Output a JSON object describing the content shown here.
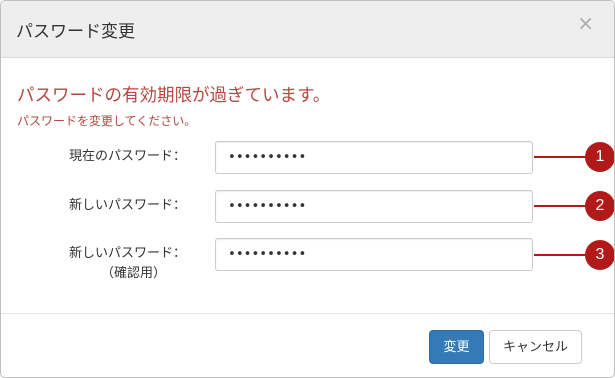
{
  "dialog": {
    "title": "パスワード変更",
    "close_glyph": "×"
  },
  "messages": {
    "main": "パスワードの有効期限が過ぎています。",
    "sub": "パスワードを変更してください。"
  },
  "fields": [
    {
      "label": "現在のパスワード：",
      "sublabel": "",
      "value": "••••••••••",
      "callout": "1"
    },
    {
      "label": "新しいパスワード：",
      "sublabel": "",
      "value": "••••••••••",
      "callout": "2"
    },
    {
      "label": "新しいパスワード：",
      "sublabel": "（確認用）",
      "value": "••••••••••",
      "callout": "3"
    }
  ],
  "buttons": {
    "submit": "変更",
    "cancel": "キャンセル"
  },
  "colors": {
    "error_text": "#b4473f",
    "callout": "#b21a1a",
    "primary": "#337ab7"
  }
}
